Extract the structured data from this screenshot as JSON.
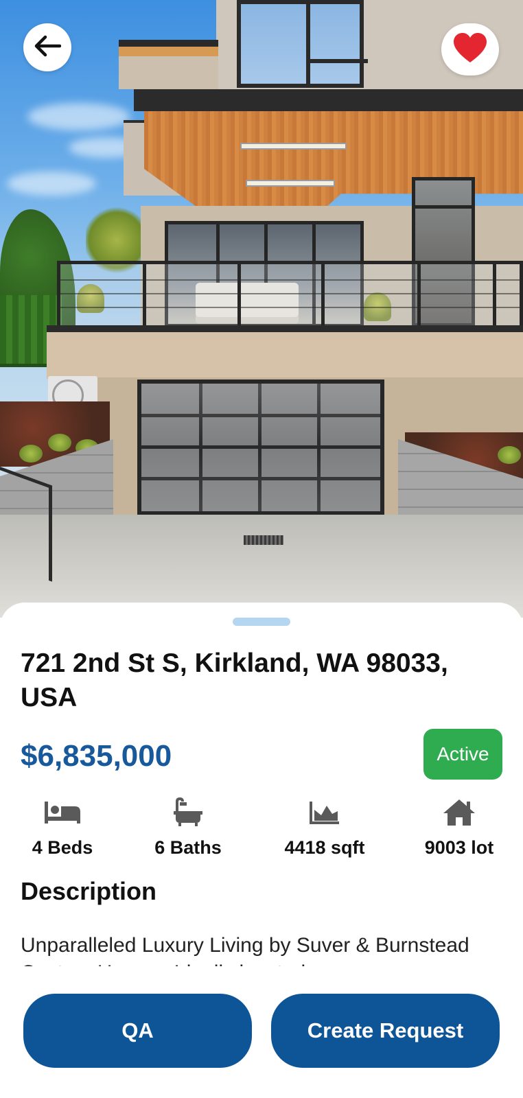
{
  "listing": {
    "address": "721 2nd St S, Kirkland, WA 98033, USA",
    "price": "$6,835,000",
    "status": "Active",
    "favorited": true
  },
  "stats": [
    {
      "icon": "bed-icon",
      "label": "4 Beds"
    },
    {
      "icon": "bathtub-icon",
      "label": "6 Baths"
    },
    {
      "icon": "area-chart-icon",
      "label": "4418 sqft"
    },
    {
      "icon": "home-icon",
      "label": "9003 lot"
    }
  ],
  "description": {
    "title": "Description",
    "text": "Unparalleled Luxury Living by Suver & Burnstead Custom Homes. Ideally located"
  },
  "actions": {
    "qa_label": "QA",
    "create_request_label": "Create Request"
  },
  "colors": {
    "primary": "#0e5597",
    "price": "#17599b",
    "status_active": "#2fac4f",
    "favorite": "#e3262f",
    "sheet_handle": "#b5d6f1"
  }
}
